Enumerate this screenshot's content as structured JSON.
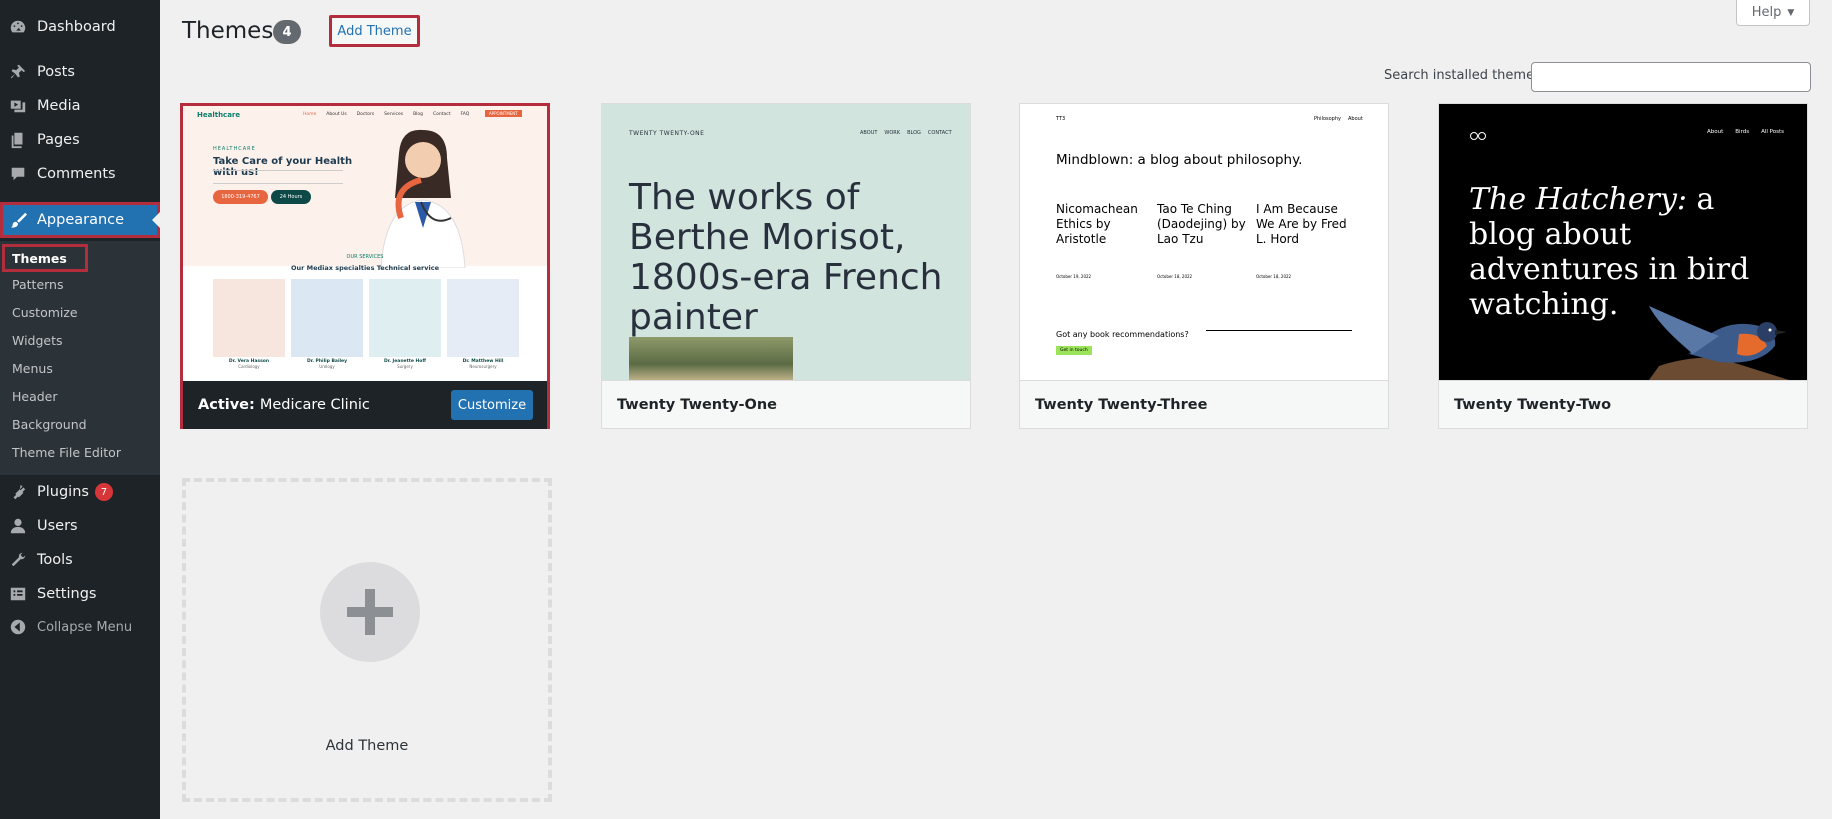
{
  "sidebar": {
    "dashboard": "Dashboard",
    "posts": "Posts",
    "media": "Media",
    "pages": "Pages",
    "comments": "Comments",
    "appearance": "Appearance",
    "submenu": [
      "Themes",
      "Patterns",
      "Customize",
      "Widgets",
      "Menus",
      "Header",
      "Background",
      "Theme File Editor"
    ],
    "plugins": "Plugins",
    "plugins_badge": "7",
    "users": "Users",
    "tools": "Tools",
    "settings": "Settings",
    "collapse": "Collapse Menu"
  },
  "header": {
    "title": "Themes",
    "count": "4",
    "add_theme": "Add Theme",
    "help": "Help"
  },
  "search": {
    "label": "Search installed themes",
    "value": ""
  },
  "themes": [
    {
      "name": "Medicare Clinic",
      "active_label": "Active:",
      "customize": "Customize"
    },
    {
      "name": "Twenty Twenty-One"
    },
    {
      "name": "Twenty Twenty-Three"
    },
    {
      "name": "Twenty Twenty-Two"
    }
  ],
  "previews": {
    "medicare": {
      "logo": "Healthcare",
      "nav": [
        "Home",
        "About Us",
        "Doctors",
        "Services",
        "Blog",
        "Contact",
        "FAQ"
      ],
      "cta": "APPOINTMENT",
      "kicker": "HEALTHCARE",
      "headline": "Take Care of your Health with us!",
      "phone": "1800-319-4767",
      "hours": "24 Hours",
      "services_kicker": "OUR SERVICES",
      "services_title": "Our Mediax specialties  Technical service",
      "doctors": [
        {
          "name": "Dr. Vera Hasson",
          "role": "Cardiology"
        },
        {
          "name": "Dr. Philip Bailey",
          "role": "Urology"
        },
        {
          "name": "Dr. Jeanette Hoff",
          "role": "Surgery"
        },
        {
          "name": "Dr. Matthew Hill",
          "role": "Neurosurgery"
        }
      ]
    },
    "t21": {
      "site": "TWENTY TWENTY-ONE",
      "nav": [
        "ABOUT",
        "WORK",
        "BLOG",
        "CONTACT"
      ],
      "headline": "The works of Berthe Morisot, 1800s-era French painter"
    },
    "t23": {
      "site": "TT3",
      "nav": [
        "Philosophy",
        "About"
      ],
      "headline": "Mindblown: a blog about philosophy.",
      "posts": [
        "Nicomachean Ethics by Aristotle",
        "Tao Te Ching (Daodejing) by Lao Tzu",
        "I Am Because We Are by Fred L. Hord"
      ],
      "dates": [
        "October 19, 2022",
        "October 18, 2022",
        "October 18, 2022"
      ],
      "footer": "Got any book recommendations?",
      "button": "Get in touch"
    },
    "t22": {
      "nav": [
        "About",
        "Birds",
        "All Posts"
      ],
      "headline_em": "The Hatchery:",
      "headline": " a blog about adventures in bird watching."
    }
  },
  "add_card": {
    "label": "Add Theme"
  },
  "colors": {
    "sidebar": "#1d2327",
    "accent": "#2271b1",
    "highlight": "#b32d3c"
  }
}
